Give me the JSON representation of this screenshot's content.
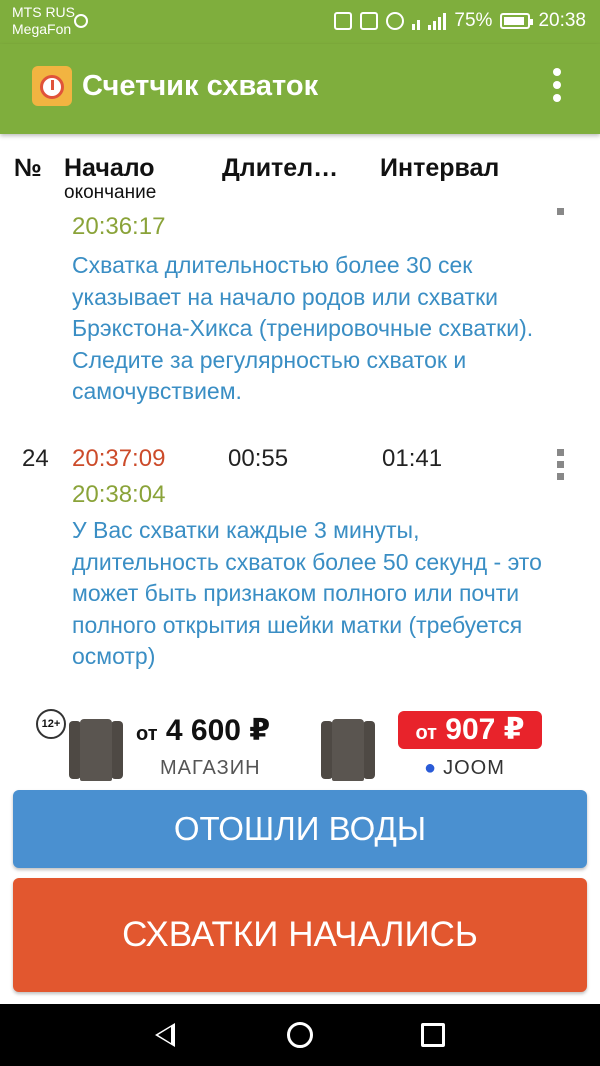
{
  "status_bar": {
    "carrier_1": "MTS RUS",
    "carrier_2": "MegaFon",
    "battery_percent": "75%",
    "time": "20:38"
  },
  "app_bar": {
    "title": "Счетчик схваток",
    "logo_icon": "stopwatch-icon",
    "menu_icon": "more-vert-icon"
  },
  "table": {
    "headers": {
      "number": "№",
      "start": "Начало",
      "start_sub": "окончание",
      "duration": "Длител…",
      "interval": "Интервал"
    },
    "rows": [
      {
        "number": "",
        "start": "",
        "end": "20:36:17",
        "duration": "",
        "interval": "",
        "advice": "Схватка длительностью более 30 сек указывает на начало родов или схватки Брэкстона-Хикса (тренировочные схватки). Следите за регулярностью схваток и самочувствием."
      },
      {
        "number": "24",
        "start": "20:37:09",
        "end": "20:38:04",
        "duration": "00:55",
        "interval": "01:41",
        "advice": "У Вас схватки каждые 3 минуты, длительность схваток более 50 секунд - это может быть признаком полного или почти полного открытия шейки матки (требуется осмотр)"
      }
    ]
  },
  "ad": {
    "age": "12+",
    "price_prefix": "от",
    "price_1": "4 600 ₽",
    "shop_label": "МАГАЗИН",
    "price_2": "907 ₽",
    "brand": "JOOM"
  },
  "buttons": {
    "water": "ОТОШЛИ ВОДЫ",
    "contractions": "СХВАТКИ НАЧАЛИСЬ"
  },
  "colors": {
    "app_green": "#7fae3d",
    "water_blue": "#4a90d0",
    "contractions_orange": "#e2572f",
    "advice_blue": "#3a8ec4",
    "time_green": "#8aa339",
    "time_red": "#cc4b2a"
  }
}
